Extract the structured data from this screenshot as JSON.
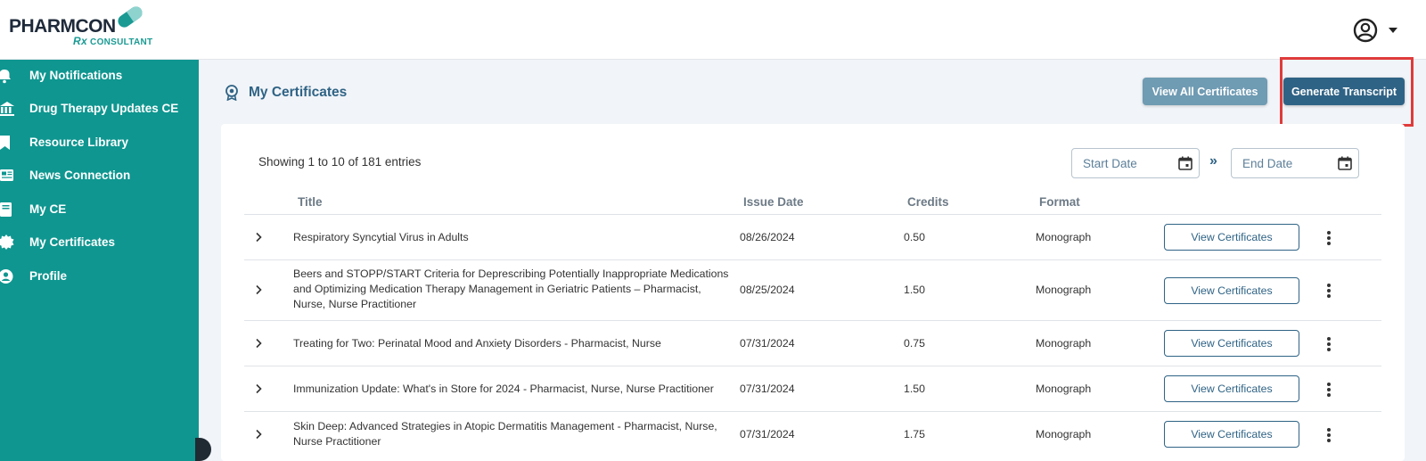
{
  "brand": {
    "name_part1": "PHARM",
    "name_part2": "CON",
    "sub_rx": "Rx",
    "sub_text": "CONSULTANT"
  },
  "sidebar": {
    "items": [
      {
        "label": "My Notifications",
        "icon": "bell-icon"
      },
      {
        "label": "Drug Therapy Updates CE",
        "icon": "bank-icon"
      },
      {
        "label": "Resource Library",
        "icon": "bookmark-icon"
      },
      {
        "label": "News Connection",
        "icon": "newspaper-icon"
      },
      {
        "label": "My CE",
        "icon": "book-icon"
      },
      {
        "label": "My Certificates",
        "icon": "certificate-icon"
      },
      {
        "label": "Profile",
        "icon": "user-circle-icon"
      }
    ]
  },
  "main": {
    "title": "My Certificates",
    "view_all_label": "View All Certificates",
    "generate_label": "Generate Transcript",
    "showing_text": "Showing 1 to 10 of 181 entries",
    "start_date_placeholder": "Start Date",
    "end_date_placeholder": "End Date",
    "range_separator": "»",
    "columns": {
      "title": "Title",
      "issue_date": "Issue Date",
      "credits": "Credits",
      "format": "Format"
    },
    "rows": [
      {
        "title": "Respiratory Syncytial Virus in Adults",
        "issue_date": "08/26/2024",
        "credits": "0.50",
        "format": "Monograph",
        "action": "View Certificates"
      },
      {
        "title": "Beers and STOPP/START Criteria for Deprescribing Potentially Inappropriate Medications and Optimizing Medication Therapy Management in Geriatric Patients – Pharmacist, Nurse, Nurse Practitioner",
        "issue_date": "08/25/2024",
        "credits": "1.50",
        "format": "Monograph",
        "action": "View Certificates"
      },
      {
        "title": "Treating for Two: Perinatal Mood and Anxiety Disorders - Pharmacist, Nurse",
        "issue_date": "07/31/2024",
        "credits": "0.75",
        "format": "Monograph",
        "action": "View Certificates"
      },
      {
        "title": "Immunization Update: What's in Store for 2024 - Pharmacist, Nurse, Nurse Practitioner",
        "issue_date": "07/31/2024",
        "credits": "1.50",
        "format": "Monograph",
        "action": "View Certificates"
      },
      {
        "title": "Skin Deep: Advanced Strategies in Atopic Dermatitis Management - Pharmacist, Nurse, Nurse Practitioner",
        "issue_date": "07/31/2024",
        "credits": "1.75",
        "format": "Monograph",
        "action": "View Certificates"
      }
    ]
  },
  "colors": {
    "sidebar_bg": "#0f9690",
    "primary": "#2f6385",
    "secondary_button": "#6f9bb3",
    "highlight": "#e03b3b"
  }
}
